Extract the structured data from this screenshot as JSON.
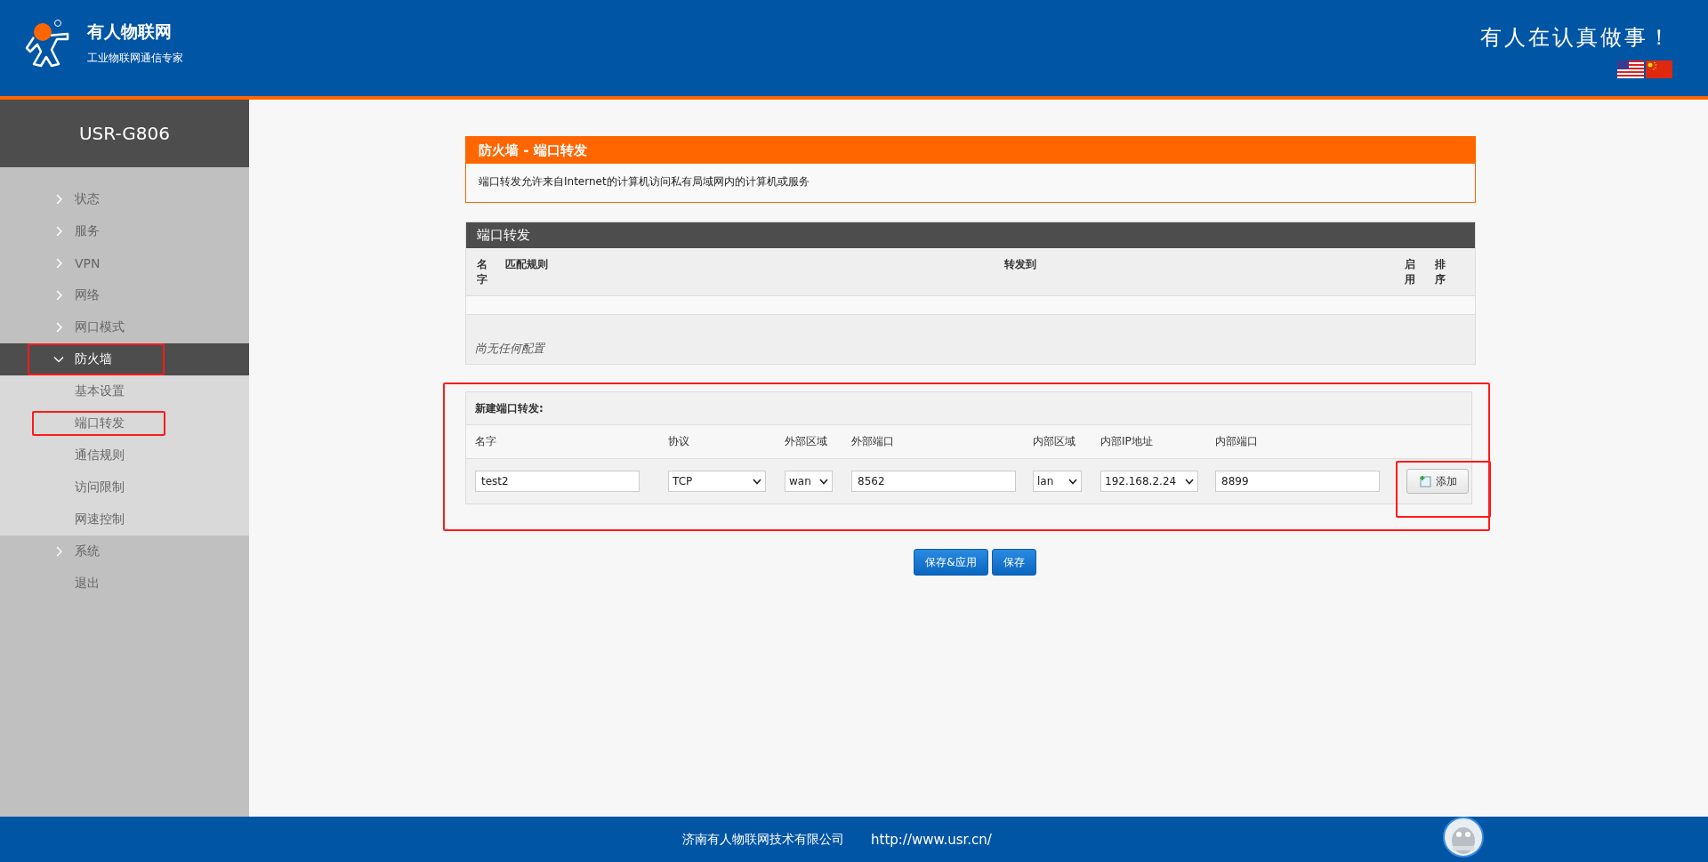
{
  "header": {
    "brand": "有人物联网",
    "tagline": "工业物联网通信专家",
    "slogan": "有人在认真做事！"
  },
  "sidebar": {
    "device": "USR-G806",
    "items": [
      {
        "label": "状态",
        "expanded": false
      },
      {
        "label": "服务",
        "expanded": false
      },
      {
        "label": "VPN",
        "expanded": false
      },
      {
        "label": "网络",
        "expanded": false
      },
      {
        "label": "网口模式",
        "expanded": false
      },
      {
        "label": "防火墙",
        "expanded": true,
        "children": [
          {
            "label": "基本设置"
          },
          {
            "label": "端口转发"
          },
          {
            "label": "通信规则"
          },
          {
            "label": "访问限制"
          },
          {
            "label": "网速控制"
          }
        ]
      },
      {
        "label": "系统",
        "expanded": false
      },
      {
        "label": "退出"
      }
    ]
  },
  "intro": {
    "title": "防火墙 - 端口转发",
    "description": "端口转发允许来自Internet的计算机访问私有局域网内的计算机或服务"
  },
  "table": {
    "title": "端口转发",
    "columns": [
      "名字",
      "匹配规则",
      "转发到",
      "启用",
      "排序"
    ],
    "empty_text": "尚无任何配置"
  },
  "new_rule": {
    "title": "新建端口转发:",
    "fields": [
      {
        "label": "名字",
        "kind": "text",
        "value": "test2"
      },
      {
        "label": "协议",
        "kind": "select",
        "value": "TCP"
      },
      {
        "label": "外部区域",
        "kind": "select",
        "value": "wan"
      },
      {
        "label": "外部端口",
        "kind": "text",
        "value": "8562"
      },
      {
        "label": "内部区域",
        "kind": "select",
        "value": "lan"
      },
      {
        "label": "内部IP地址",
        "kind": "select",
        "value": "192.168.2.24"
      },
      {
        "label": "内部端口",
        "kind": "text",
        "value": "8899"
      }
    ],
    "add_button": "添加"
  },
  "actions": [
    "保存&应用",
    "保存"
  ],
  "footer": {
    "company": "济南有人物联网技术有限公司",
    "url": "http://www.usr.cn/"
  }
}
